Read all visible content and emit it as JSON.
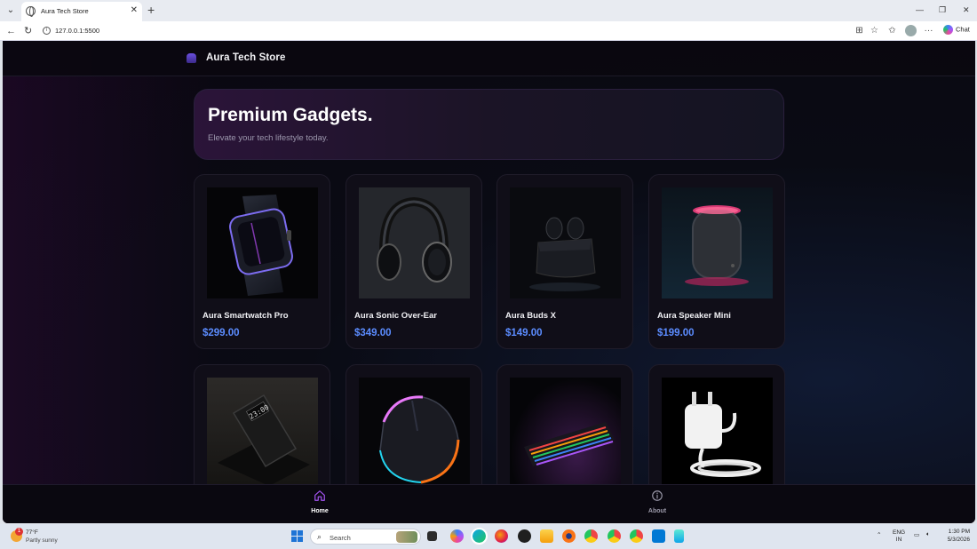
{
  "browser": {
    "tab_title": "Aura Tech Store",
    "url": "127.0.0.1:5500",
    "chat_label": "Chat"
  },
  "site": {
    "brand": "Aura Tech Store",
    "hero_title": "Premium Gadgets.",
    "hero_subtitle": "Elevate your tech lifestyle today."
  },
  "products": [
    {
      "name": "Aura Smartwatch Pro",
      "price": "$299.00",
      "image": "smartwatch"
    },
    {
      "name": "Aura Sonic Over-Ear",
      "price": "$349.00",
      "image": "headphones"
    },
    {
      "name": "Aura Buds X",
      "price": "$149.00",
      "image": "earbuds"
    },
    {
      "name": "Aura Speaker Mini",
      "price": "$199.00",
      "image": "speaker"
    },
    {
      "name": "",
      "price": "",
      "image": "power-bank",
      "display": "23:00"
    },
    {
      "name": "",
      "price": "",
      "image": "gaming-mouse"
    },
    {
      "name": "",
      "price": "",
      "image": "keyboard"
    },
    {
      "name": "",
      "price": "",
      "image": "charger"
    }
  ],
  "bottom_nav": {
    "home_label": "Home",
    "about_label": "About",
    "active_color": "#a855f7",
    "inactive_color": "#9a98a8"
  },
  "taskbar": {
    "weather_temp": "77°F",
    "weather_desc": "Partly sunny",
    "weather_badge": "1",
    "search_placeholder": "Search",
    "lang_primary": "ENG",
    "lang_secondary": "IN",
    "time": "1:30 PM",
    "date": "5/3/2026"
  },
  "colors": {
    "accent_price": "#5b8cff",
    "page_bg": "#0a0710"
  }
}
